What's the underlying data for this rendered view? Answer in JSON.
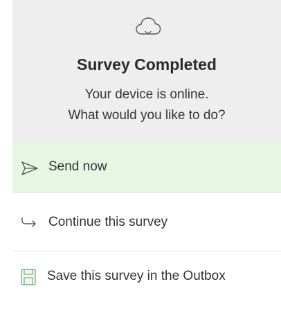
{
  "dialog": {
    "icon": "cloud-icon",
    "title": "Survey Completed",
    "message_line1": "Your device is online.",
    "message_line2": "What would you like to do?"
  },
  "options": [
    {
      "label": "Send now",
      "icon": "send-icon",
      "highlighted": true,
      "highlight_color": "#e6f6e3",
      "icon_color": "#555555"
    },
    {
      "label": "Continue this survey",
      "icon": "arrow-right-icon",
      "highlighted": false,
      "icon_color": "#555555"
    },
    {
      "label": "Save this survey in the Outbox",
      "icon": "save-icon",
      "highlighted": false,
      "icon_color": "#7fb58a"
    }
  ]
}
